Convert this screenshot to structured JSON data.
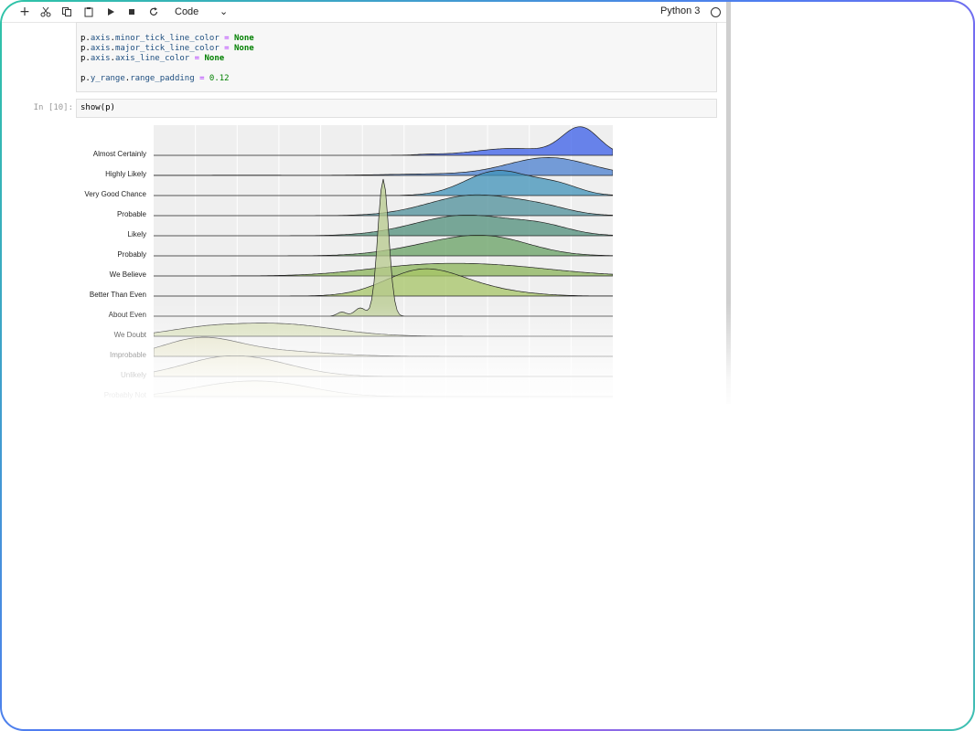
{
  "toolbar": {
    "cell_type": "Code",
    "kernel": "Python 3",
    "icons": [
      "add-icon",
      "cut-icon",
      "copy-icon",
      "paste-icon",
      "run-icon",
      "stop-icon",
      "restart-icon"
    ]
  },
  "cells": {
    "previous_code": [
      "p.axis.minor_tick_line_color = None",
      "p.axis.major_tick_line_color = None",
      "p.axis.axis_line_color = None",
      "",
      "p.y_range.range_padding = 0.12"
    ],
    "show_cell": {
      "prompt": "In [10]:",
      "code": "show(p)"
    }
  },
  "chart_data": {
    "type": "area",
    "categories": [
      "Almost Certainly",
      "Highly Likely",
      "Very Good Chance",
      "Probable",
      "Likely",
      "Probably",
      "We Believe",
      "Better Than Even",
      "About Even",
      "We Doubt",
      "Improbable",
      "Unlikely",
      "Probably Not"
    ],
    "xlim": [
      0,
      100
    ],
    "grid": true,
    "colors": [
      "#3a5ee8",
      "#4a7fcf",
      "#3f92b8",
      "#4d8f9a",
      "#4f8e7a",
      "#67a063",
      "#8ab358",
      "#a6c466",
      "#b7c98c",
      "#cdd7a6",
      "#dcdbb4",
      "#e3dfbd",
      "#e8e4c6"
    ]
  }
}
